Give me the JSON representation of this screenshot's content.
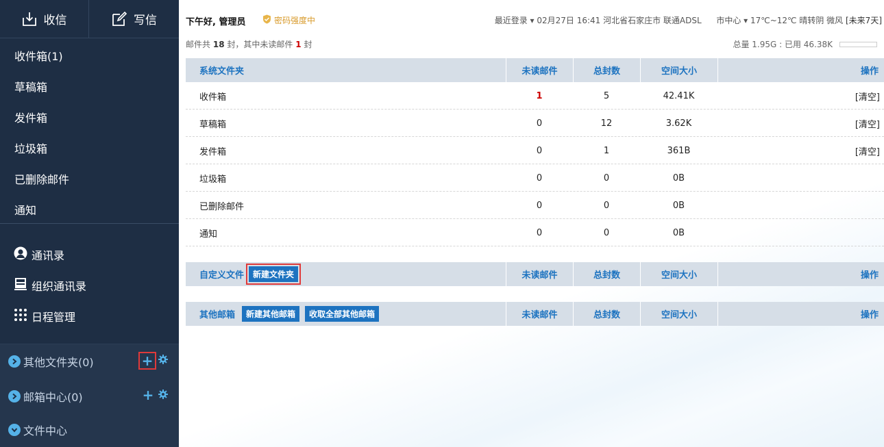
{
  "sidebar": {
    "receive_label": "收信",
    "compose_label": "写信",
    "folders": [
      {
        "label": "收件箱(1)"
      },
      {
        "label": "草稿箱"
      },
      {
        "label": "发件箱"
      },
      {
        "label": "垃圾箱"
      },
      {
        "label": "已删除邮件"
      },
      {
        "label": "通知"
      }
    ],
    "tools": [
      {
        "label": "通讯录",
        "icon": "contacts-icon"
      },
      {
        "label": "组织通讯录",
        "icon": "org-contacts-icon"
      },
      {
        "label": "日程管理",
        "icon": "calendar-grid-icon"
      }
    ],
    "groups": [
      {
        "label": "其他文件夹(0)"
      },
      {
        "label": "邮箱中心(0)"
      },
      {
        "label": "文件中心"
      }
    ]
  },
  "header": {
    "greeting": "下午好, 管理员",
    "password_strength": "密码强度中",
    "last_login": "最近登录 ▾ 02月27日 16:41 河北省石家庄市 联通ADSL",
    "weather": "市中心 ▾  17℃~12℃ 晴转阴 微风",
    "weather_link": "[未来7天]"
  },
  "summary": {
    "text_prefix": "邮件共",
    "total": "18",
    "text_mid": "封，其中未读邮件",
    "unread": "1",
    "text_suffix": "封",
    "quota": "总量 1.95G : 已用 46.38K"
  },
  "system_folders": {
    "header": {
      "name": "系统文件夹",
      "unread": "未读邮件",
      "total": "总封数",
      "size": "空间大小",
      "action": "操作"
    },
    "rows": [
      {
        "name": "收件箱",
        "unread": "1",
        "total": "5",
        "size": "42.41K",
        "action": "[清空]"
      },
      {
        "name": "草稿箱",
        "unread": "0",
        "total": "12",
        "size": "3.62K",
        "action": "[清空]"
      },
      {
        "name": "发件箱",
        "unread": "0",
        "total": "1",
        "size": "361B",
        "action": "[清空]"
      },
      {
        "name": "垃圾箱",
        "unread": "0",
        "total": "0",
        "size": "0B",
        "action": ""
      },
      {
        "name": "已删除邮件",
        "unread": "0",
        "total": "0",
        "size": "0B",
        "action": ""
      },
      {
        "name": "通知",
        "unread": "0",
        "total": "0",
        "size": "0B",
        "action": ""
      }
    ]
  },
  "custom_folders": {
    "name": "自定义文件",
    "new_button": "新建文件夹",
    "unread": "未读邮件",
    "total": "总封数",
    "size": "空间大小",
    "action": "操作"
  },
  "other_mailboxes": {
    "name": "其他邮箱",
    "new_button": "新建其他邮箱",
    "fetch_button": "收取全部其他邮箱",
    "unread": "未读邮件",
    "total": "总封数",
    "size": "空间大小",
    "action": "操作"
  }
}
